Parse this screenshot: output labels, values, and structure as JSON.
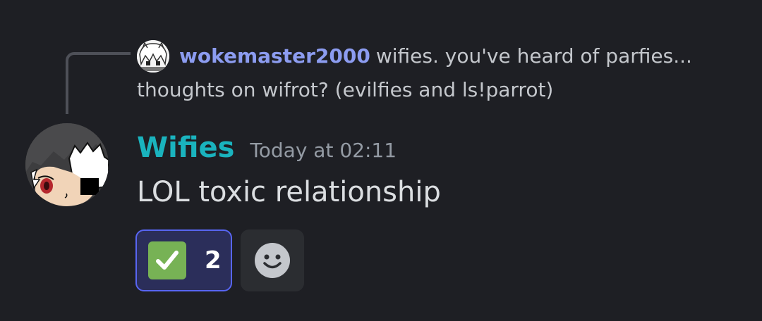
{
  "reply": {
    "author": "wokemaster2000",
    "text_line1": "wifies. you've heard of parfies...",
    "text_line2": "thoughts on wifrot? (evilfies and ls!parrot)",
    "avatar_icon": "anime-character-avatar"
  },
  "message": {
    "author": "Wifies",
    "author_color": "#1ab3be",
    "timestamp": "Today at 02:11",
    "content": "LOL toxic relationship",
    "avatar_icon": "anime-character-avatar"
  },
  "reactions": [
    {
      "emoji": "check-mark-icon",
      "count": "2",
      "active": true
    }
  ],
  "add_reaction": {
    "icon": "smiley-icon"
  },
  "colors": {
    "background": "#1e1f24",
    "reply_author": "#8c9cf0",
    "reaction_border": "#5865f2",
    "reaction_bg": "#2b2e5a",
    "check_green": "#77b255"
  }
}
